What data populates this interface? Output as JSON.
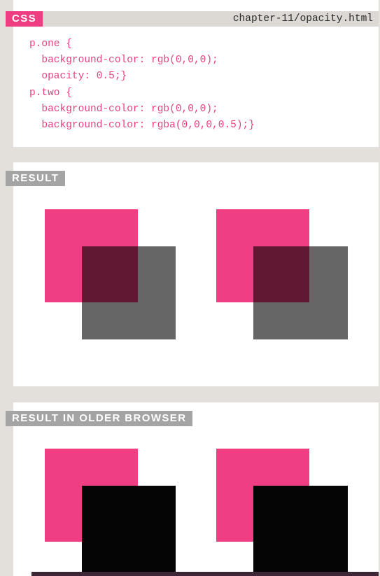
{
  "css_section": {
    "tag": "CSS",
    "file": "chapter-11/opacity.html",
    "code_lines": [
      "p.one {",
      "  background-color: rgb(0,0,0);",
      "  opacity: 0.5;}",
      "p.two {",
      "  background-color: rgb(0,0,0);",
      "  background-color: rgba(0,0,0,0.5);}"
    ]
  },
  "result_section": {
    "tag": "RESULT"
  },
  "older_section": {
    "tag": "RESULT IN OLDER BROWSER"
  },
  "colors": {
    "page_background": "#e3dfdb",
    "accent_pink": "#ef3e81",
    "tag_gray": "#a5a4a4",
    "code_text": "#e8407f",
    "black_box": "#050505"
  }
}
